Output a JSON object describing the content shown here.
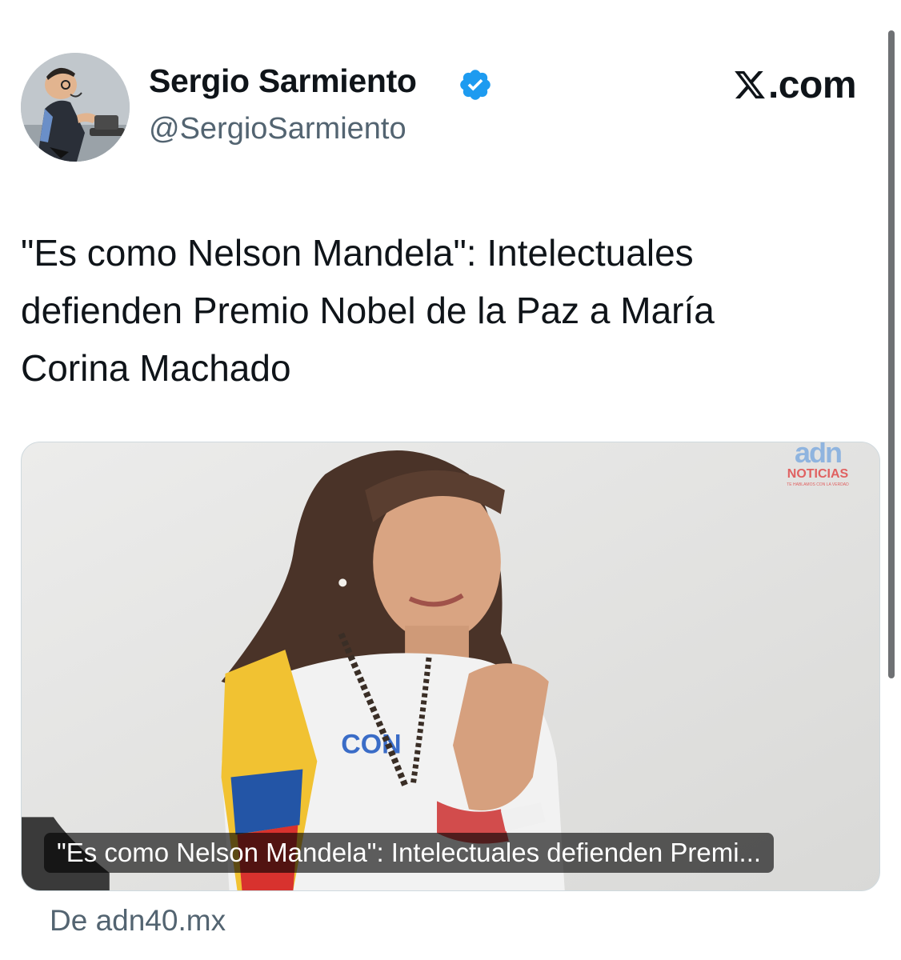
{
  "author": {
    "name": "Sergio Sarmiento",
    "handle": "@SergioSarmiento",
    "verified": true,
    "avatar_icon": "caricature-avatar"
  },
  "brand": {
    "text": ".com",
    "icon": "x-logo-icon"
  },
  "tweet": {
    "text": "\"Es como Nelson Mandela\": Intelectuales defienden Premio Nobel de la Paz a María Corina Machado"
  },
  "link_card": {
    "caption": "\"Es como Nelson Mandela\": Intelectuales defienden Premi...",
    "source": "De adn40.mx",
    "watermark": {
      "logo": "adn",
      "word": "NOTICIAS",
      "tagline": "TE HABLAMOS CON LA VERDAD"
    }
  },
  "colors": {
    "text_primary": "#0f1419",
    "text_secondary": "#536471",
    "verified_blue": "#1d9bf0",
    "card_border": "#cfd9de"
  }
}
